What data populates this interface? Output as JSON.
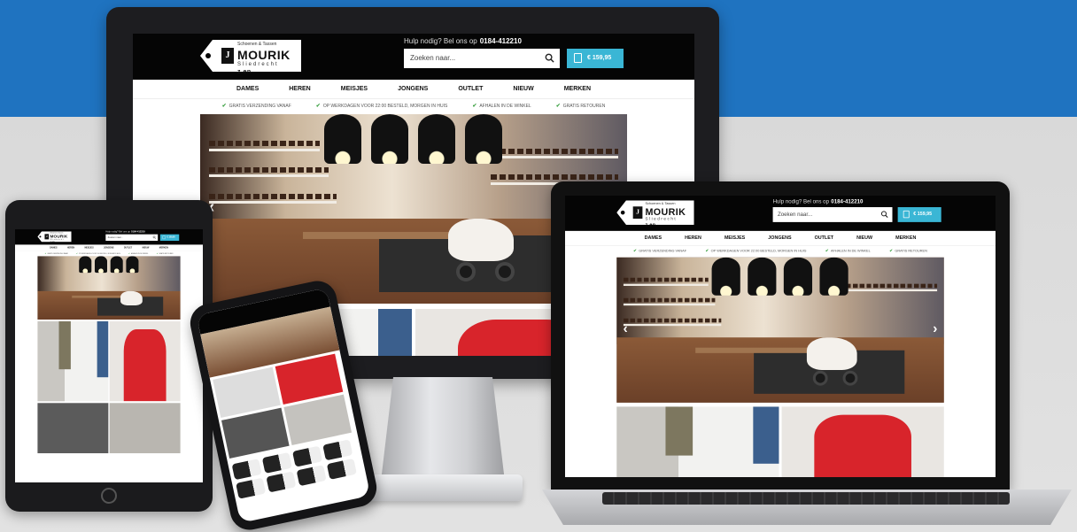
{
  "site": {
    "logo": {
      "mark": "J",
      "name": "MOURIK",
      "suffix": "z.en",
      "tagline": "Sliedrecht",
      "small_text": "Schoenen & Tassen"
    },
    "help_text": "Hulp nodig? Bel ons op",
    "phone": "0184-412210",
    "search_placeholder": "Zoeken naar...",
    "cart_total": "€ 159,95",
    "nav": [
      "DAMES",
      "HEREN",
      "MEISJES",
      "JONGENS",
      "OUTLET",
      "NIEUW",
      "MERKEN"
    ],
    "usps": [
      "GRATIS VERZENDING VANAF",
      "OP WERKDAGEN VOOR 22:00 BESTELD, MORGEN IN HUIS",
      "AFHALEN IN DE WINKEL",
      "GRATIS RETOUREN"
    ]
  },
  "colors": {
    "background_top": "#1f73c0",
    "background_bottom": "#dcdcdc",
    "header": "#050505",
    "cart_accent": "#3ab6d5",
    "check": "#3aa041"
  }
}
